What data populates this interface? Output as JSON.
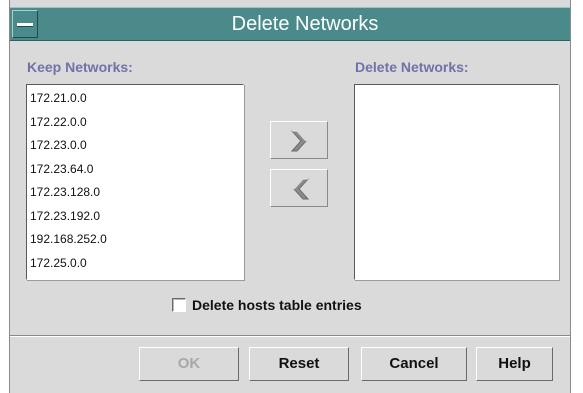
{
  "window": {
    "title": "Delete Networks"
  },
  "keep": {
    "label": "Keep Networks:",
    "items": [
      "172.21.0.0",
      "172.22.0.0",
      "172.23.0.0",
      "172.23.64.0",
      "172.23.128.0",
      "172.23.192.0",
      "192.168.252.0",
      "172.25.0.0"
    ]
  },
  "delete": {
    "label": "Delete Networks:",
    "items": []
  },
  "options": {
    "delete_hosts_label": "Delete hosts table entries",
    "delete_hosts_checked": false
  },
  "buttons": {
    "ok": "OK",
    "ok_enabled": false,
    "reset": "Reset",
    "cancel": "Cancel",
    "help": "Help"
  },
  "icons": {
    "move_right": "double-chevron-right-icon",
    "move_left": "double-chevron-left-icon",
    "window_menu": "window-menu-icon"
  },
  "colors": {
    "titlebar": "#4a8a8a",
    "section_label": "#7072a8",
    "dialog_bg": "#dadada"
  }
}
